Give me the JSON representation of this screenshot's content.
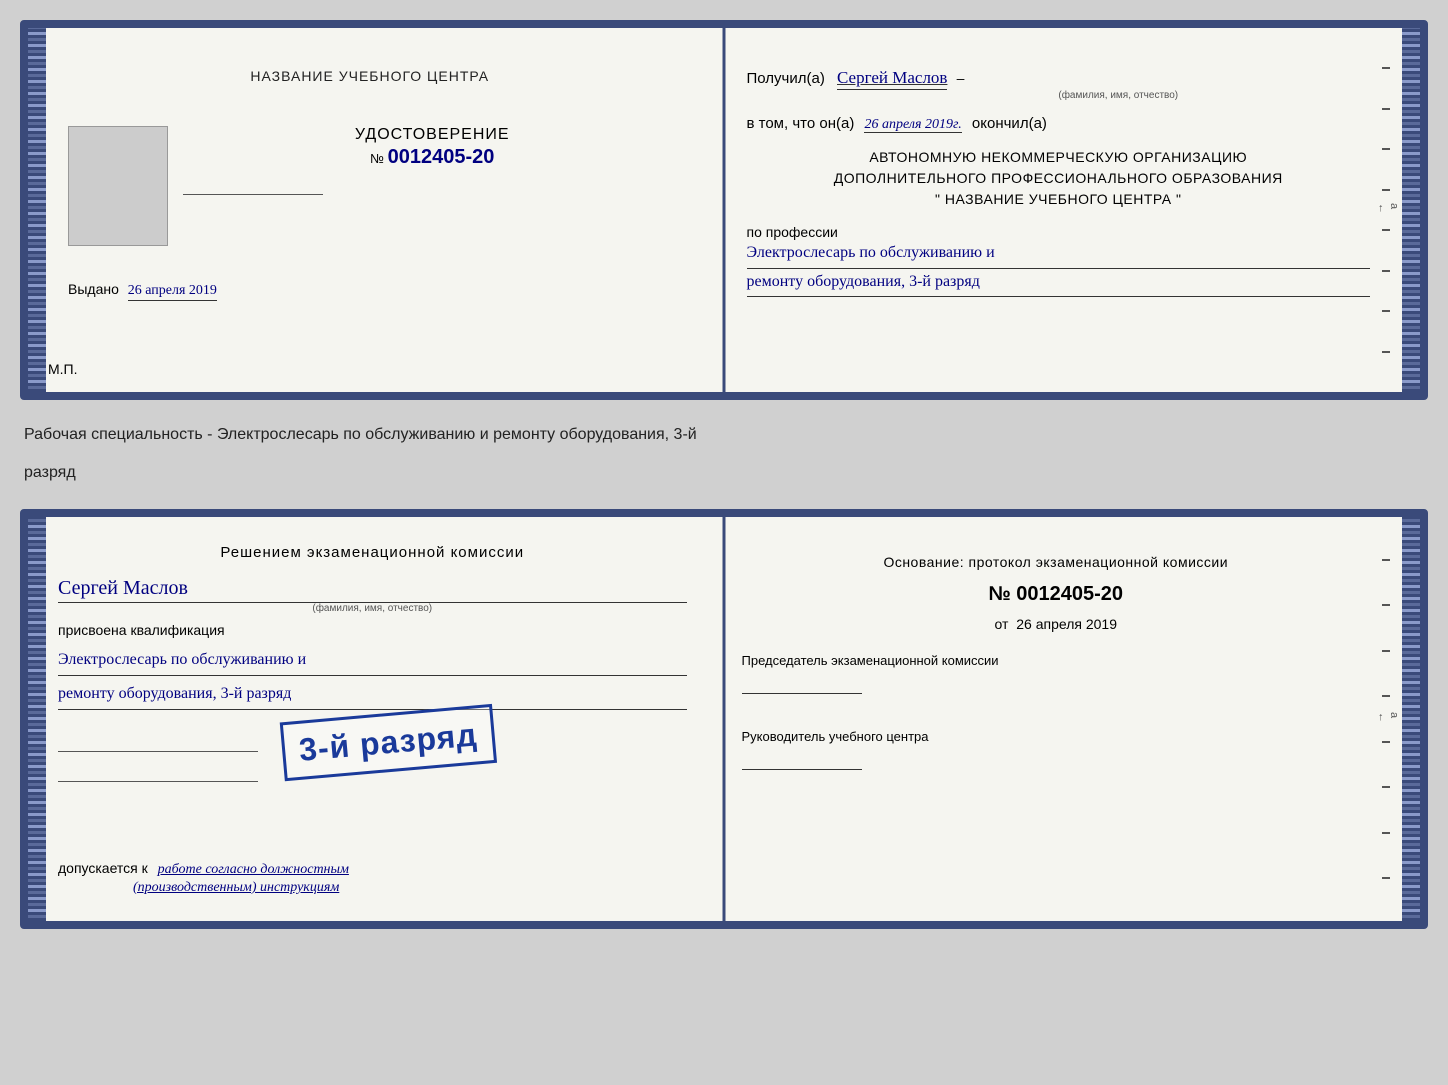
{
  "cert1": {
    "left": {
      "title": "НАЗВАНИЕ УЧЕБНОГО ЦЕНТРА",
      "udostoverenie_label": "УДОСТОВЕРЕНИЕ",
      "number_prefix": "№",
      "number": "0012405-20",
      "vydano_label": "Выдано",
      "vydano_date": "26 апреля 2019",
      "mp_label": "М.П."
    },
    "right": {
      "received_label": "Получил(а)",
      "recipient_name": "Сергей Маслов",
      "fio_sub": "(фамилия, имя, отчество)",
      "vtom_label": "в том, что он(а)",
      "date_value": "26 апреля 2019г.",
      "okончил_label": "окончил(а)",
      "org_line1": "АВТОНОМНУЮ НЕКОММЕРЧЕСКУЮ ОРГАНИЗАЦИЮ",
      "org_line2": "ДОПОЛНИТЕЛЬНОГО ПРОФЕССИОНАЛЬНОГО ОБРАЗОВАНИЯ",
      "org_line3": "\"   НАЗВАНИЕ УЧЕБНОГО ЦЕНТРА   \"",
      "po_professii_label": "по профессии",
      "profession_line1": "Электрослесарь по обслуживанию и",
      "profession_line2": "ремонту оборудования, 3-й разряд",
      "vertical_text": "и а ←"
    }
  },
  "specialty_text": "Рабочая специальность - Электрослесарь по обслуживанию и ремонту оборудования, 3-й",
  "specialty_text2": "разряд",
  "cert2": {
    "left": {
      "resheniye_title": "Решением экзаменационной комиссии",
      "name": "Сергей Маслов",
      "fio_sub": "(фамилия, имя, отчество)",
      "prisvoyena": "присвоена квалификация",
      "profession_line1": "Электрослесарь по обслуживанию и",
      "profession_line2": "ремонту оборудования, 3-й разряд",
      "dopuskaetsya_prefix": "допускается к",
      "dopuskaetsya_text": "работе согласно должностным",
      "dopuskaetsya_text2": "(производственным) инструкциям"
    },
    "stamp": "3-й разряд",
    "right": {
      "osnovaniye": "Основание: протокол экзаменационной комиссии",
      "number_prefix": "№",
      "number": "0012405-20",
      "ot_prefix": "от",
      "ot_date": "26 апреля 2019",
      "predsedatel_label": "Председатель экзаменационной комиссии",
      "rukovoditel_label": "Руководитель учебного центра",
      "vertical_text": "и а ←"
    }
  }
}
